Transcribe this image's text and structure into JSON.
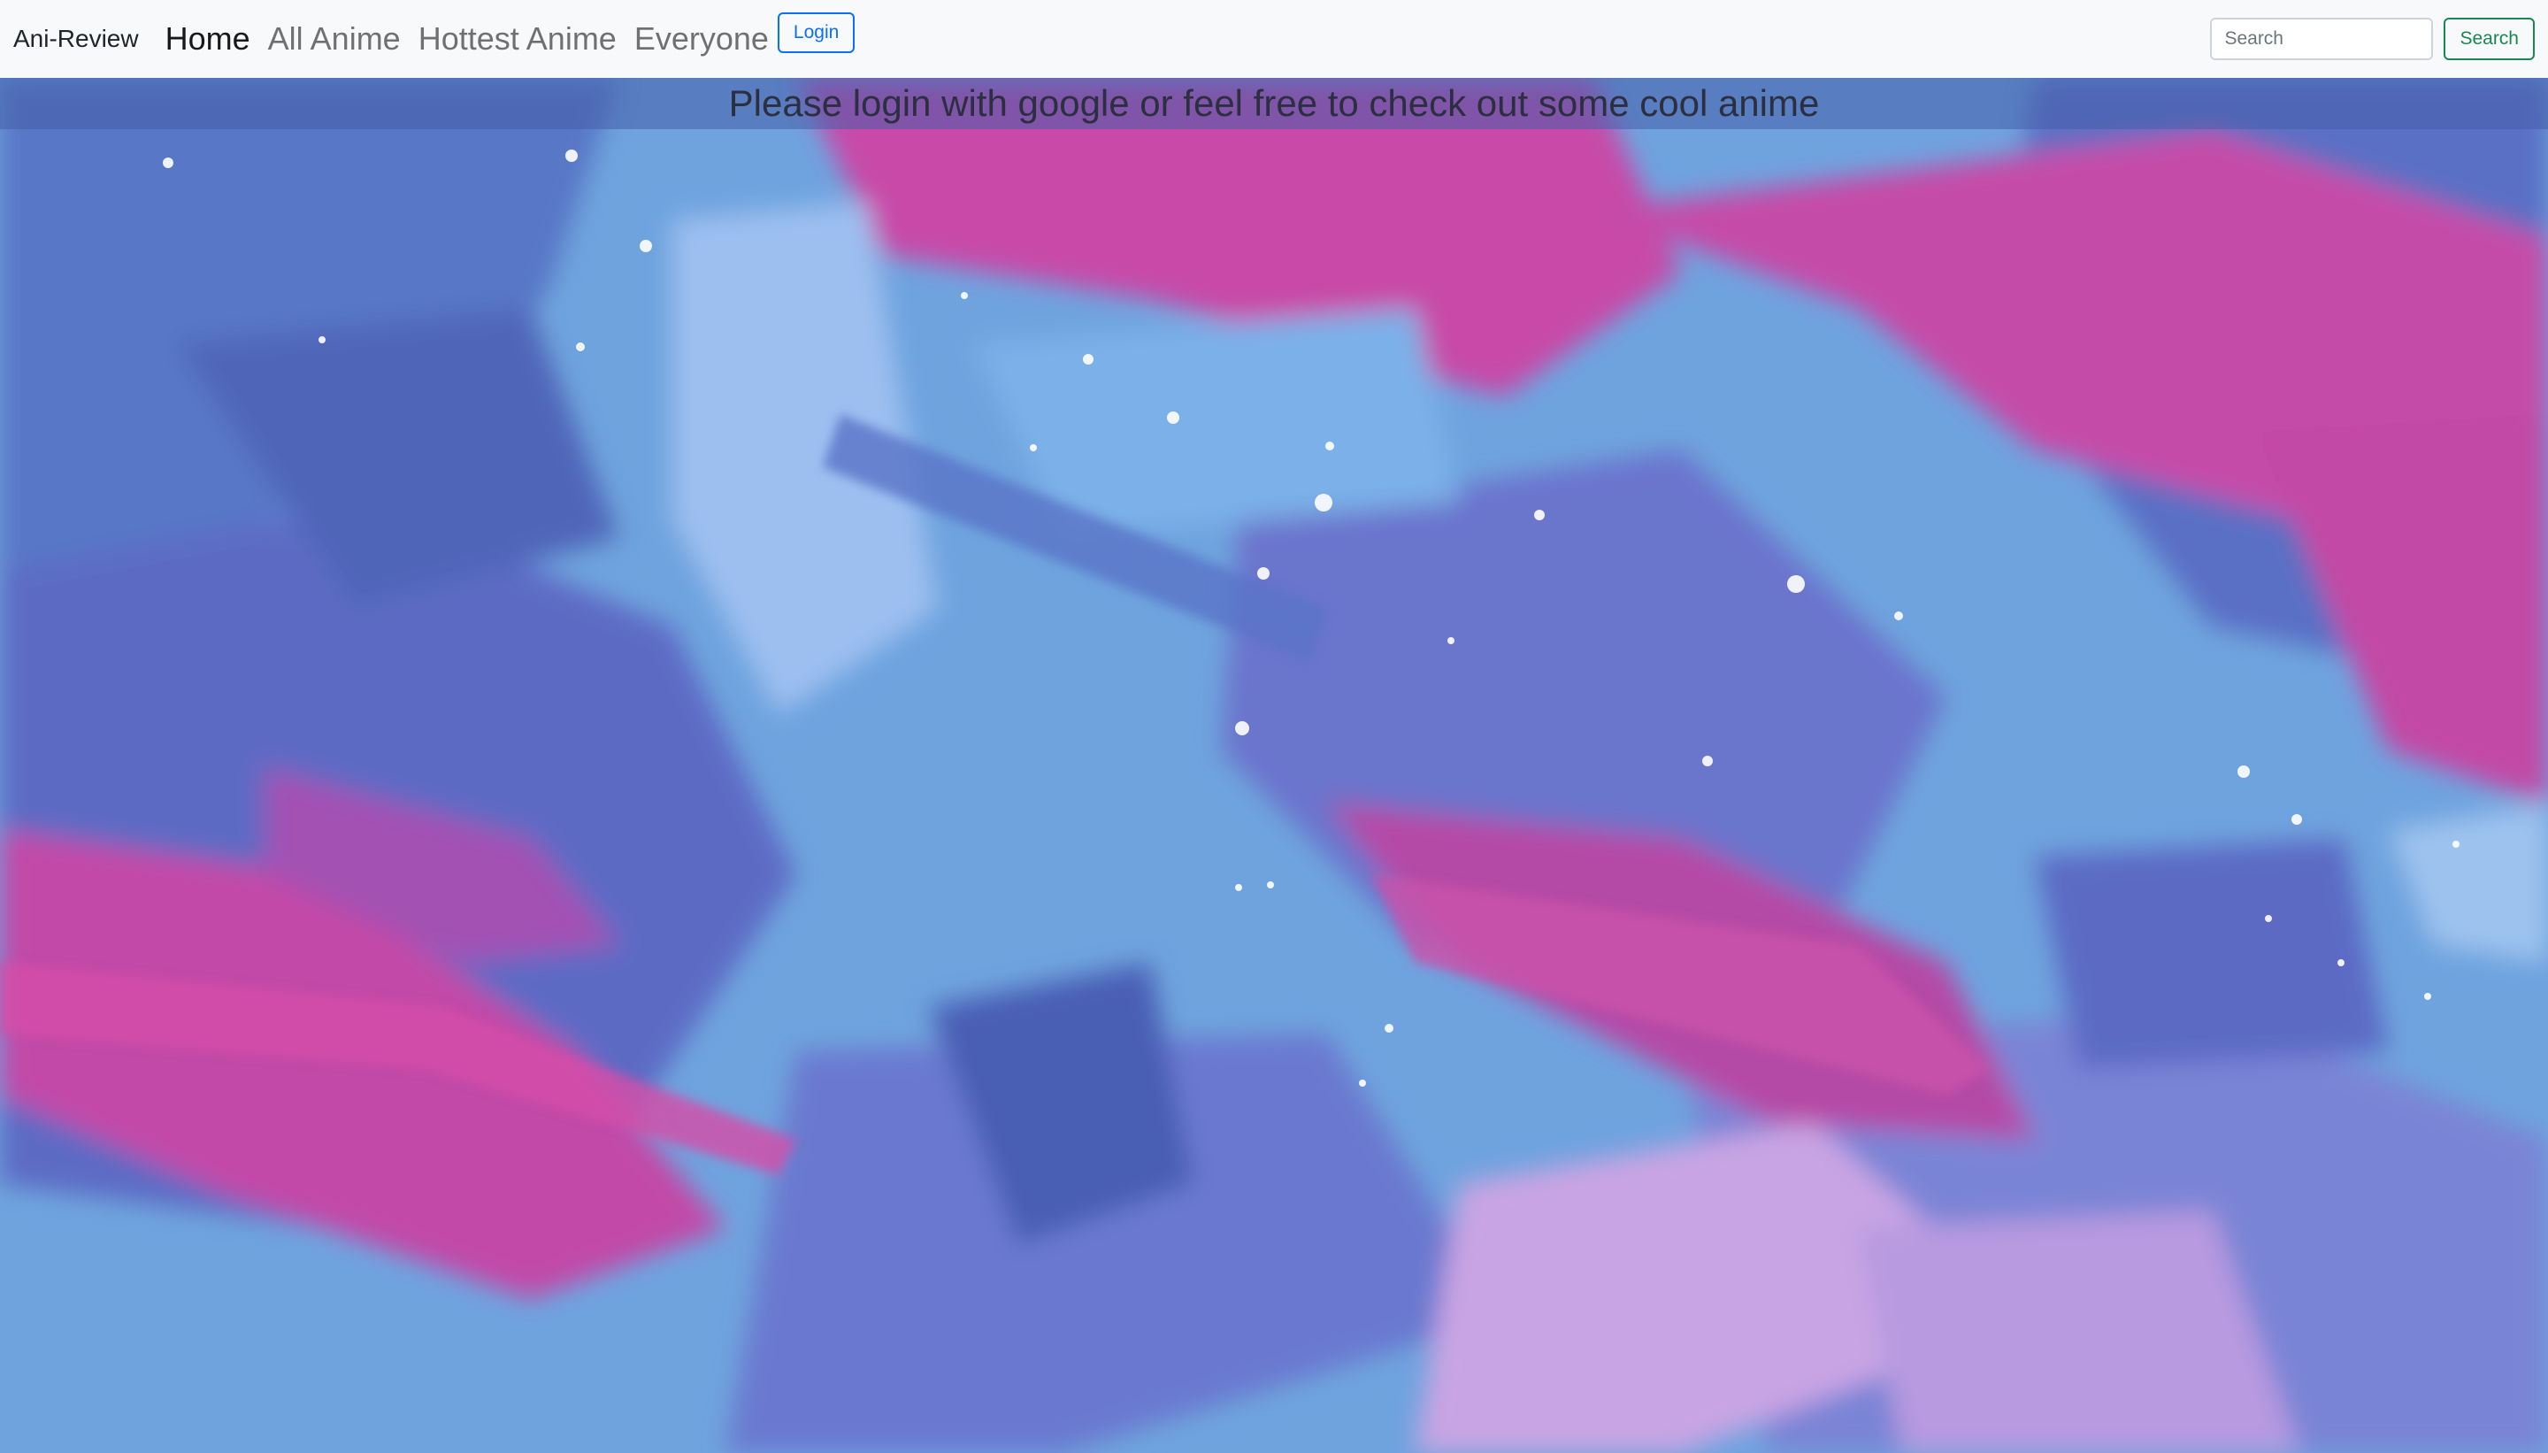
{
  "navbar": {
    "brand": "Ani-Review",
    "links": [
      {
        "label": "Home",
        "active": true
      },
      {
        "label": "All Anime",
        "active": false
      },
      {
        "label": "Hottest Anime",
        "active": false
      },
      {
        "label": "Everyone",
        "active": false
      }
    ],
    "login_label": "Login",
    "search": {
      "placeholder": "Search",
      "value": "",
      "button_label": "Search"
    }
  },
  "hero": {
    "message": "Please login with google or feel free to check out some cool anime"
  },
  "colors": {
    "navbar_bg": "#f8f9fa",
    "login_accent": "#0d6efd",
    "search_accent": "#198754",
    "background_blue": "#6fa0dc",
    "background_pink": "#d94aa6",
    "background_purple": "#6a6cc8"
  }
}
